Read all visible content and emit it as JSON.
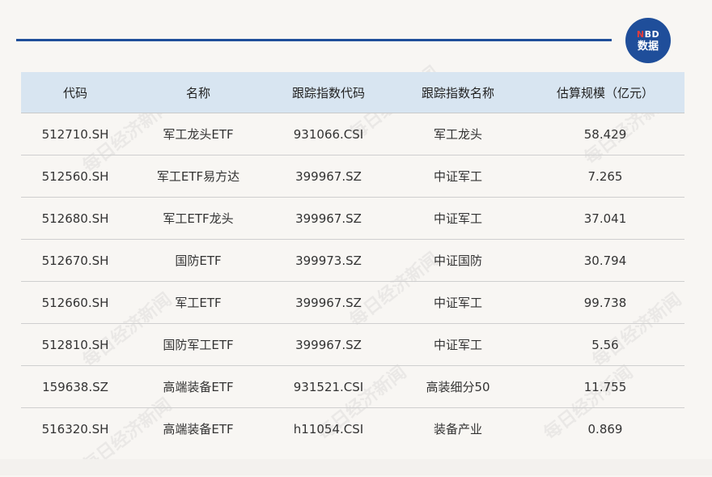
{
  "logo": {
    "line1_n": "N",
    "line1_rest": "BD",
    "line2": "数据"
  },
  "watermark": "每日经济新闻",
  "table": {
    "headers": [
      "代码",
      "名称",
      "跟踪指数代码",
      "跟踪指数名称",
      "估算规模（亿元）"
    ],
    "rows": [
      [
        "512710.SH",
        "军工龙头ETF",
        "931066.CSI",
        "军工龙头",
        "58.429"
      ],
      [
        "512560.SH",
        "军工ETF易方达",
        "399967.SZ",
        "中证军工",
        "7.265"
      ],
      [
        "512680.SH",
        "军工ETF龙头",
        "399967.SZ",
        "中证军工",
        "37.041"
      ],
      [
        "512670.SH",
        "国防ETF",
        "399973.SZ",
        "中证国防",
        "30.794"
      ],
      [
        "512660.SH",
        "军工ETF",
        "399967.SZ",
        "中证军工",
        "99.738"
      ],
      [
        "512810.SH",
        "国防军工ETF",
        "399967.SZ",
        "中证军工",
        "5.56"
      ],
      [
        "159638.SZ",
        "高端装备ETF",
        "931521.CSI",
        "高装细分50",
        "11.755"
      ],
      [
        "516320.SH",
        "高端装备ETF",
        "h11054.CSI",
        "装备产业",
        "0.869"
      ]
    ]
  }
}
